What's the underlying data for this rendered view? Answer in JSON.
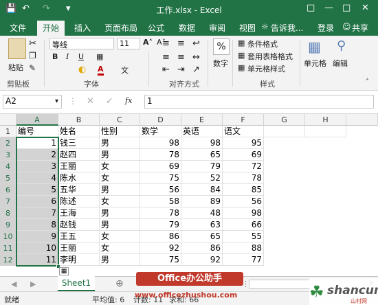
{
  "titlebar": {
    "title": "工作.xlsx - Excel",
    "save_icon": "save-icon",
    "undo_icon": "undo-icon",
    "redo_icon": "redo-icon"
  },
  "tabs": {
    "file": "文件",
    "home": "开始",
    "insert": "插入",
    "layout": "页面布局",
    "formula": "公式",
    "data": "数据",
    "review": "审阅",
    "view": "视图",
    "tell": "告诉我...",
    "login": "登录",
    "share": "共享"
  },
  "ribbon": {
    "paste": "粘贴",
    "font_name": "等线",
    "font_size": "11",
    "number_fmt": "数字",
    "percent": "%",
    "cond_fmt": "条件格式",
    "table_fmt": "套用表格格式",
    "cell_style": "单元格样式",
    "cells": "单元格",
    "edit": "编辑",
    "group_clipboard": "剪贴板",
    "group_font": "字体",
    "group_align": "对齐方式",
    "group_style": "样式"
  },
  "formulabar": {
    "namebox": "A2",
    "fx": "fx",
    "value": "1"
  },
  "columns": [
    "A",
    "B",
    "C",
    "D",
    "E",
    "F",
    "G",
    "H"
  ],
  "rows": [
    "1",
    "2",
    "3",
    "4",
    "5",
    "6",
    "7",
    "8",
    "9",
    "10",
    "11",
    "12"
  ],
  "table": [
    [
      "编号",
      "姓名",
      "性别",
      "数学",
      "英语",
      "语文"
    ],
    [
      "1",
      "钱三",
      "男",
      "98",
      "98",
      "95"
    ],
    [
      "2",
      "赵四",
      "男",
      "78",
      "65",
      "69"
    ],
    [
      "3",
      "王丽",
      "女",
      "69",
      "79",
      "72"
    ],
    [
      "4",
      "陈水",
      "女",
      "75",
      "52",
      "78"
    ],
    [
      "5",
      "五华",
      "男",
      "56",
      "84",
      "85"
    ],
    [
      "6",
      "陈述",
      "女",
      "58",
      "89",
      "56"
    ],
    [
      "7",
      "王海",
      "男",
      "78",
      "48",
      "98"
    ],
    [
      "8",
      "赵钱",
      "男",
      "79",
      "63",
      "66"
    ],
    [
      "9",
      "王五",
      "女",
      "86",
      "65",
      "55"
    ],
    [
      "10",
      "王丽",
      "女",
      "92",
      "86",
      "88"
    ],
    [
      "11",
      "李明",
      "男",
      "75",
      "92",
      "77"
    ]
  ],
  "sheet": {
    "tab": "Sheet1"
  },
  "status": {
    "ready": "就绪",
    "average": "平均值: 6",
    "count": "计数: 11",
    "sum": "求和: 66"
  },
  "watermark": {
    "brand": "Office办公助手",
    "url": "www.officezhushou.com",
    "logo": "shancun",
    "logo_sub": "山村网"
  },
  "colors": {
    "accent": "#217346",
    "watermark_red": "#c0392b"
  }
}
